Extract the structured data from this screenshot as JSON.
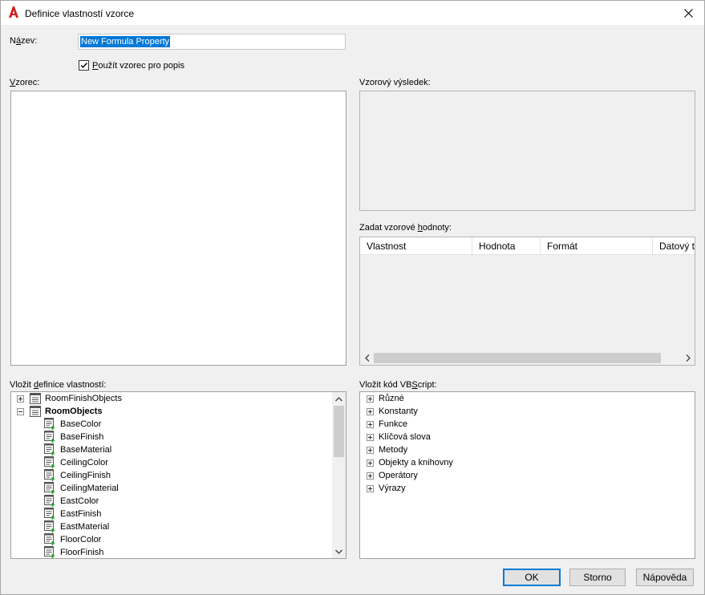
{
  "window": {
    "title": "Definice vlastností vzorce"
  },
  "name_field": {
    "label_pre": "N",
    "label_u": "á",
    "label_post": "zev:",
    "value": "New Formula Property"
  },
  "use_formula_checkbox": {
    "checked": true,
    "label_u": "P",
    "label_post": "oužít vzorec pro popis"
  },
  "formula": {
    "label_u": "V",
    "label_post": "zorec:",
    "value": ""
  },
  "sample_result": {
    "label": "Vzorový výsledek:"
  },
  "sample_values": {
    "label_pre": "Zadat vzorové ",
    "label_u": "h",
    "label_post": "odnoty:",
    "columns": [
      "Vlastnost",
      "Hodnota",
      "Formát",
      "Datový typ"
    ]
  },
  "insert_properties": {
    "label_pre": "Vložit ",
    "label_u": "d",
    "label_post": "efinice vlastností:",
    "groups": [
      {
        "name": "RoomFinishObjects",
        "expanded": false
      },
      {
        "name": "RoomObjects",
        "expanded": true
      }
    ],
    "items": [
      "BaseColor",
      "BaseFinish",
      "BaseMaterial",
      "CeilingColor",
      "CeilingFinish",
      "CeilingMaterial",
      "EastColor",
      "EastFinish",
      "EastMaterial",
      "FloorColor",
      "FloorFinish"
    ]
  },
  "vbscript": {
    "label_pre": "Vložit kód VB",
    "label_u": "S",
    "label_post": "cript:",
    "items": [
      "Různé",
      "Konstanty",
      "Funkce",
      "Klíčová slova",
      "Metody",
      "Objekty a knihovny",
      "Operátory",
      "Výrazy"
    ]
  },
  "buttons": {
    "ok": "OK",
    "cancel": "Storno",
    "help": "Nápověda"
  },
  "colors": {
    "selection": "#0078d7",
    "app_icon": "#d21d1d",
    "tree_plus": "#2c9a2c"
  }
}
